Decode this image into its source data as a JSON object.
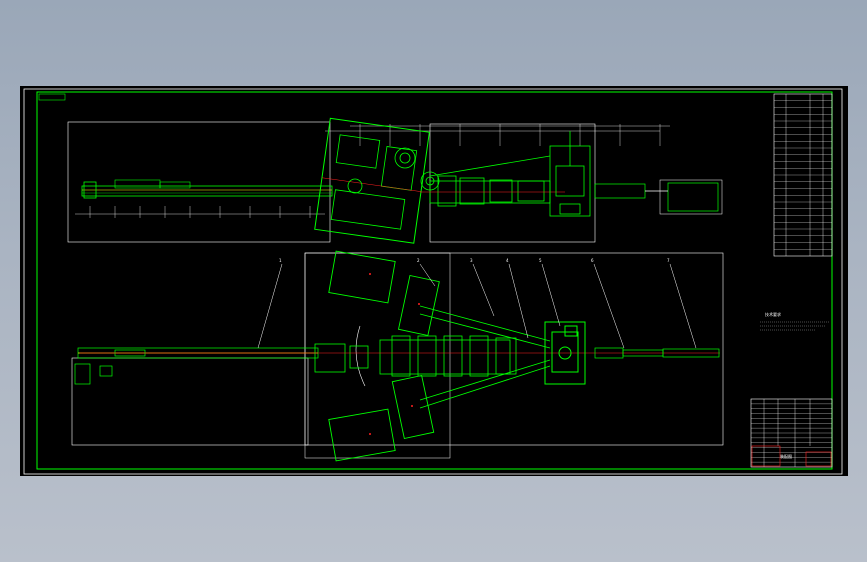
{
  "drawing": {
    "background_color": "#000000",
    "frame_color": "#00ff00",
    "outline_color": "#ffffff",
    "centerline_color": "#ff2020",
    "accent_color": "#ffff00",
    "balloon_numbers": [
      "1",
      "2",
      "3",
      "4",
      "5",
      "6",
      "7"
    ],
    "notes_title": "技术要求",
    "title_block_name": "装配图",
    "parts_list_rows": 24,
    "title_block_rows": 14
  }
}
